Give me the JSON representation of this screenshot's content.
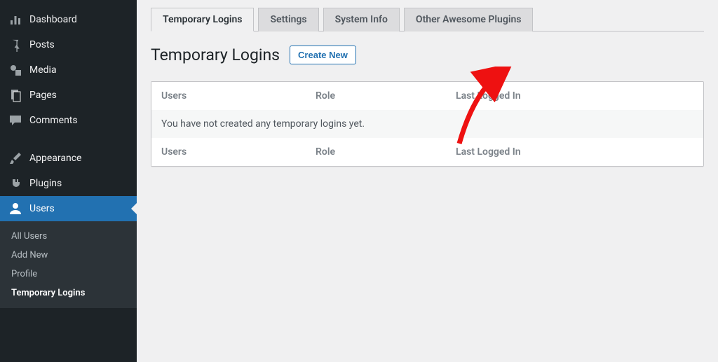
{
  "sidebar": {
    "items": [
      {
        "label": "Dashboard",
        "icon": "dashboard"
      },
      {
        "label": "Posts",
        "icon": "pin"
      },
      {
        "label": "Media",
        "icon": "media"
      },
      {
        "label": "Pages",
        "icon": "pages"
      },
      {
        "label": "Comments",
        "icon": "comments"
      },
      {
        "label": "Appearance",
        "icon": "brush"
      },
      {
        "label": "Plugins",
        "icon": "plug"
      },
      {
        "label": "Users",
        "icon": "user"
      }
    ],
    "submenu": [
      {
        "label": "All Users"
      },
      {
        "label": "Add New"
      },
      {
        "label": "Profile"
      },
      {
        "label": "Temporary Logins"
      }
    ]
  },
  "tabs": [
    {
      "label": "Temporary Logins"
    },
    {
      "label": "Settings"
    },
    {
      "label": "System Info"
    },
    {
      "label": "Other Awesome Plugins"
    }
  ],
  "page": {
    "title": "Temporary Logins",
    "create_button": "Create New"
  },
  "table": {
    "cols": {
      "users": "Users",
      "role": "Role",
      "last": "Last Logged In"
    },
    "empty_msg": "You have not created any temporary logins yet."
  }
}
